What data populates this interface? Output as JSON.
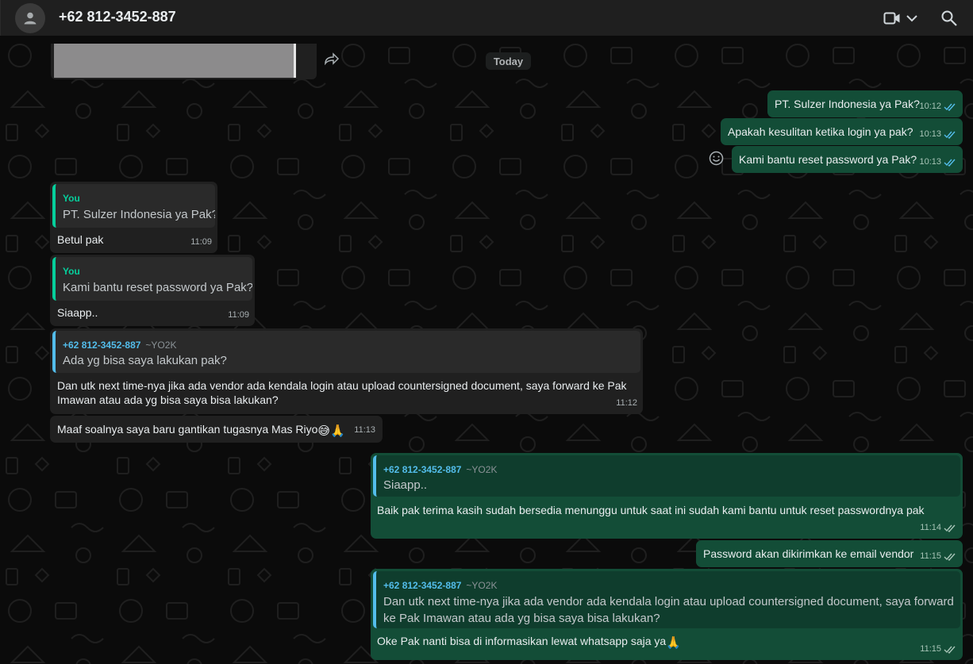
{
  "header": {
    "contact_name": "+62 812-3452-887",
    "icons": [
      "person-avatar-icon",
      "video-call-icon",
      "chevron-down-icon",
      "search-icon"
    ]
  },
  "chat": {
    "date_divider": "Today",
    "colors": {
      "incoming": "#202020",
      "outgoing": "#134d37",
      "quote_you": "#06cf9c",
      "quote_contact": "#53bdeb",
      "read_tick": "#53bdeb"
    },
    "messages": [
      {
        "text": "PT. Sulzer Indonesia ya Pak?",
        "time": "10:12"
      },
      {
        "text": "Apakah kesulitan ketika login ya pak?",
        "time": "10:13"
      },
      {
        "text": "Kami bantu reset password ya Pak?",
        "time": "10:13"
      },
      {
        "quote_author": "You",
        "quote_text": "PT. Sulzer Indonesia ya Pak?",
        "text": "Betul pak",
        "time": "11:09"
      },
      {
        "quote_author": "You",
        "quote_text": "Kami bantu reset password ya Pak?",
        "text": "Siaapp..",
        "time": "11:09"
      },
      {
        "quote_author": "+62 812-3452-887",
        "quote_pushname": "~YO2K",
        "quote_text": "Ada yg bisa saya lakukan pak?",
        "text": "Dan utk next time-nya jika ada vendor ada kendala login atau upload countersigned document, saya forward ke Pak Imawan atau ada yg bisa saya bisa lakukan?",
        "time": "11:12"
      },
      {
        "text": "Maaf soalnya saya baru gantikan tugasnya Mas Riyo",
        "emoji": "😅🙏",
        "time": "11:13"
      },
      {
        "quote_author": "+62 812-3452-887",
        "quote_pushname": "~YO2K",
        "quote_text": "Siaapp..",
        "text": "Baik pak terima kasih sudah bersedia menunggu untuk saat ini sudah kami bantu untuk reset passwordnya pak",
        "time": "11:14"
      },
      {
        "text": "Password akan dikirimkan ke email vendor",
        "time": "11:15"
      },
      {
        "quote_author": "+62 812-3452-887",
        "quote_pushname": "~YO2K",
        "quote_text": "Dan utk next time-nya jika ada vendor ada kendala login atau upload countersigned document, saya forward ke Pak Imawan atau ada yg bisa saya bisa lakukan?",
        "text": "Oke Pak nanti bisa di informasikan lewat whatsapp saja ya",
        "emoji": "🙏",
        "time": "11:15"
      }
    ]
  }
}
